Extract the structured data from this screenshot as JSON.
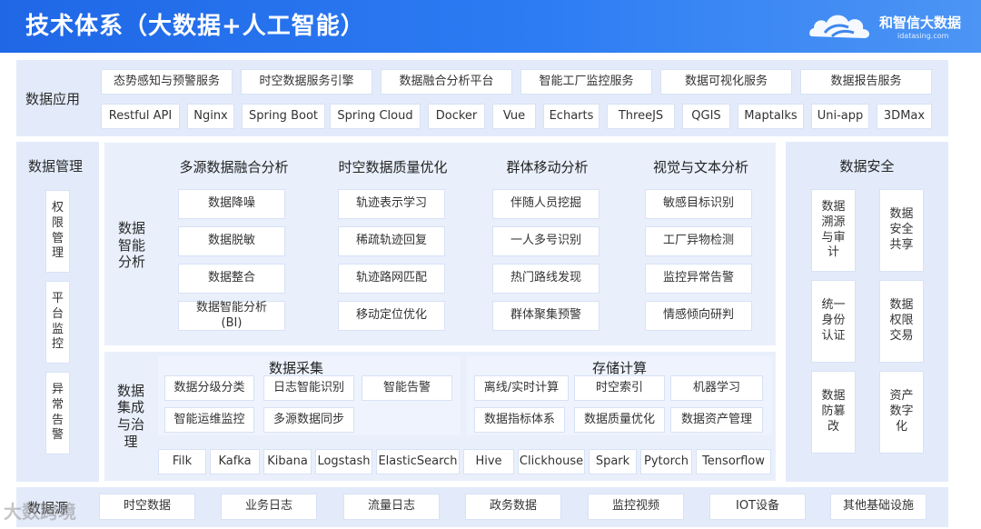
{
  "title": "技术体系（大数据+人工智能）",
  "brand": {
    "name": "和智信大数据",
    "url": "idatasing.com"
  },
  "data_app": {
    "label": "数据应用",
    "services": [
      "态势感知与预警服务",
      "时空数据服务引擎",
      "数据融合分析平台",
      "智能工厂监控服务",
      "数据可视化服务",
      "数据报告服务"
    ],
    "tech": [
      "Restful API",
      "Nginx",
      "Spring Boot",
      "Spring Cloud",
      "Docker",
      "Vue",
      "Echarts",
      "ThreeJS",
      "QGIS",
      "Maptalks",
      "Uni-app",
      "3DMax"
    ]
  },
  "data_mgmt": {
    "label": "数据管理",
    "items": [
      "权限管理",
      "平台监控",
      "异常告警"
    ]
  },
  "intel": {
    "label": "数据智能分析",
    "columns": [
      {
        "title": "多源数据融合分析",
        "items": [
          "数据降噪",
          "数据脱敏",
          "数据整合",
          "数据智能分析\n(BI)"
        ]
      },
      {
        "title": "时空数据质量优化",
        "items": [
          "轨迹表示学习",
          "稀疏轨迹回复",
          "轨迹路网匹配",
          "移动定位优化"
        ]
      },
      {
        "title": "群体移动分析",
        "items": [
          "伴随人员挖掘",
          "一人多号识别",
          "热门路线发现",
          "群体聚集预警"
        ]
      },
      {
        "title": "视觉与文本分析",
        "items": [
          "敏感目标识别",
          "工厂异物检测",
          "监控异常告警",
          "情感倾向研判"
        ]
      }
    ]
  },
  "integ": {
    "label": "数据集成与治理",
    "collect": {
      "title": "数据采集",
      "items": [
        "数据分级分类",
        "日志智能识别",
        "智能告警",
        "智能运维监控",
        "多源数据同步"
      ]
    },
    "storage": {
      "title": "存储计算",
      "items": [
        "离线/实时计算",
        "时空索引",
        "机器学习",
        "数据指标体系",
        "数据质量优化",
        "数据资产管理"
      ]
    },
    "tech": [
      "Filk",
      "Kafka",
      "Kibana",
      "Logstash",
      "ElasticSearch",
      "Hive",
      "Clickhouse",
      "Spark",
      "Pytorch",
      "Tensorflow"
    ]
  },
  "security": {
    "label": "数据安全",
    "items": [
      "数据溯源与审计",
      "数据安全共享",
      "统一身份认证",
      "数据权限交易",
      "数据防篡改",
      "资产数字化"
    ]
  },
  "sources": {
    "label": "数据源",
    "items": [
      "时空数据",
      "业务日志",
      "流量日志",
      "政务数据",
      "监控视频",
      "IOT设备",
      "其他基础设施"
    ]
  },
  "watermark": "大数跨境"
}
